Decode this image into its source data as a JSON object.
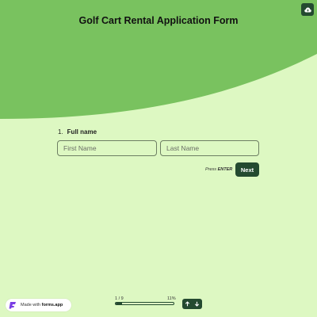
{
  "header": {
    "title": "Golf Cart Rental Application Form",
    "wave_color": "#79c25f",
    "cloud_button_icon": "cloud-upload-icon"
  },
  "question": {
    "number": "1.",
    "label": "Full name",
    "first_name_placeholder": "First Name",
    "first_name_value": "",
    "last_name_placeholder": "Last Name",
    "last_name_value": ""
  },
  "actions": {
    "press_prefix": "Press",
    "press_key": "ENTER",
    "next_label": "Next"
  },
  "footer": {
    "badge_prefix": "Made with",
    "badge_brand": "forms.app",
    "badge_icon": "forms-app-logo-icon",
    "progress_count": "1 / 9",
    "progress_percent": "11%",
    "progress_value": 0.11,
    "nav_up_icon": "arrow-up-icon",
    "nav_down_icon": "arrow-down-icon"
  },
  "colors": {
    "background": "#ddf8c2",
    "accent": "#79c25f",
    "button": "#244a30"
  }
}
